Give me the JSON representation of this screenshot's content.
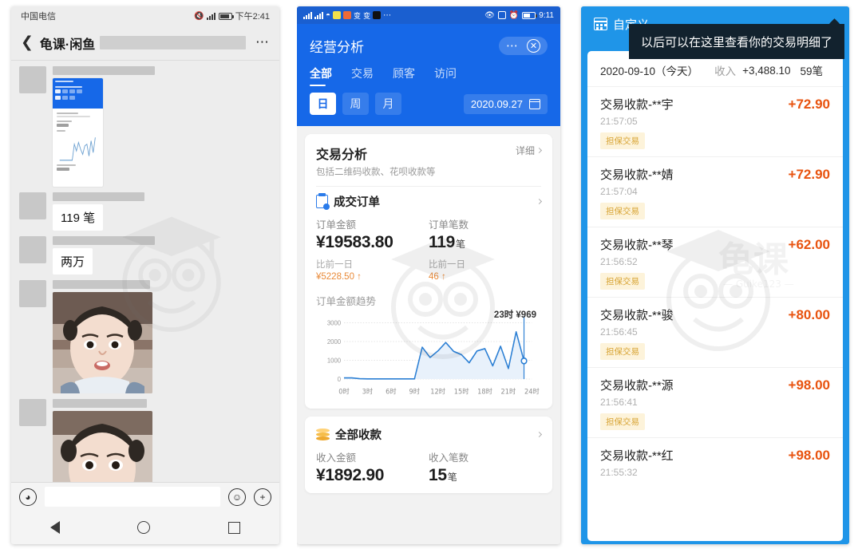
{
  "left_panel": {
    "status_bar": {
      "carrier": "中国电信",
      "time": "下午2:41",
      "mute_icon": "mute-icon",
      "signal_icon": "signal-icon",
      "battery_icon": "battery-icon"
    },
    "nav": {
      "back_icon": "back-chevron-icon",
      "title": "龟课·闲鱼",
      "more_icon": "more-dots-icon"
    },
    "messages": [
      {
        "type": "image",
        "name_masked": true,
        "thumb_alt": "business-analysis-screenshot"
      },
      {
        "type": "text",
        "text": "119 笔"
      },
      {
        "type": "text",
        "text": "两万"
      },
      {
        "type": "photo",
        "photo_alt": "child-portrait-1"
      },
      {
        "type": "photo",
        "photo_alt": "child-portrait-2"
      }
    ],
    "input_bar": {
      "voice_icon": "voice-icon",
      "placeholder": "",
      "value": "",
      "emoji_icon": "emoji-icon",
      "plus_icon": "plus-icon"
    },
    "system_nav": {
      "back_icon": "android-back-icon",
      "home_icon": "android-home-icon",
      "recents_icon": "android-recents-icon"
    }
  },
  "mid_panel": {
    "status_bar": {
      "time": "9:11",
      "icons": [
        "signal-icon",
        "signal-icon",
        "wifi-icon",
        "app-icon",
        "app-icon",
        "alipay-icon",
        "alipay-icon",
        "tiktok-icon",
        "more-icon"
      ],
      "right_icons": [
        "eye-icon",
        "nfc-icon",
        "alarm-icon",
        "battery-icon"
      ]
    },
    "header": {
      "title": "经营分析",
      "more_icon": "more-dots-icon",
      "close_icon": "close-icon"
    },
    "tabs": [
      {
        "label": "全部",
        "active": true
      },
      {
        "label": "交易",
        "active": false
      },
      {
        "label": "顾客",
        "active": false
      },
      {
        "label": "访问",
        "active": false
      }
    ],
    "ranges": [
      {
        "label": "日",
        "selected": true
      },
      {
        "label": "周",
        "selected": false
      },
      {
        "label": "月",
        "selected": false
      }
    ],
    "date_picker": {
      "value": "2020.09.27",
      "calendar_icon": "calendar-icon"
    },
    "trade_card": {
      "title": "交易分析",
      "subtitle": "包括二维码收款、花呗收款等",
      "detail_label": "详细",
      "detail_chevron": "chevron-right-icon",
      "section": {
        "icon": "order-clipboard-icon",
        "title": "成交订单",
        "chevron": "chevron-right-icon"
      },
      "stats": [
        {
          "label": "订单金额",
          "value": "¥19583.80",
          "unit": "",
          "compare_label": "比前一日",
          "delta": "¥5228.50 ↑"
        },
        {
          "label": "订单笔数",
          "value": "119",
          "unit": "笔",
          "compare_label": "比前一日",
          "delta": "46 ↑"
        }
      ],
      "trend_title": "订单金额趋势",
      "chart_note": "23时 ¥969"
    },
    "income_card": {
      "section": {
        "icon": "coins-icon",
        "title": "全部收款",
        "chevron": "chevron-right-icon"
      },
      "stats": [
        {
          "label": "收入金额",
          "value": "¥1892.90",
          "unit": ""
        },
        {
          "label": "收入笔数",
          "value": "15",
          "unit": "笔"
        }
      ]
    }
  },
  "right_panel": {
    "header": {
      "calendar_icon": "calendar-icon",
      "title": "自定义"
    },
    "tooltip": {
      "text": "以后可以在这里查看你的交易明细了"
    },
    "summary": {
      "date": "2020-09-10（今天）",
      "income_label": "收入",
      "income_amount": "+3,488.10",
      "count": "59笔"
    },
    "transactions": [
      {
        "title": "交易收款-**宇",
        "time": "21:57:05",
        "tag": "担保交易",
        "amount": "+72.90"
      },
      {
        "title": "交易收款-**婧",
        "time": "21:57:04",
        "tag": "担保交易",
        "amount": "+72.90"
      },
      {
        "title": "交易收款-**琴",
        "time": "21:56:52",
        "tag": "担保交易",
        "amount": "+62.00"
      },
      {
        "title": "交易收款-**骏",
        "time": "21:56:45",
        "tag": "担保交易",
        "amount": "+80.00"
      },
      {
        "title": "交易收款-**源",
        "time": "21:56:41",
        "tag": "担保交易",
        "amount": "+98.00"
      },
      {
        "title": "交易收款-**红",
        "time": "21:55:32",
        "tag": "",
        "amount": "+98.00"
      }
    ]
  },
  "colors": {
    "mid_header_blue": "#1668e8",
    "mid_status_blue": "#1a5fd0",
    "right_blue": "#1f95e8",
    "amount_orange": "#e8530f",
    "delta_orange": "#e98a38",
    "tag_bg": "#fdf3da",
    "tag_text": "#d8a434",
    "chart_line": "#2b7fd4"
  },
  "chart_data": {
    "type": "line",
    "title": "订单金额趋势",
    "xlabel": "",
    "ylabel": "",
    "ylim": [
      0,
      3000
    ],
    "yticks": [
      0,
      1000,
      2000,
      3000
    ],
    "xticks": [
      "0时",
      "3时",
      "6时",
      "9时",
      "12时",
      "15时",
      "18时",
      "21时",
      "24时"
    ],
    "grid": true,
    "legend": "none",
    "annotation": "23时 ¥969",
    "x": [
      0,
      1,
      2,
      3,
      4,
      5,
      6,
      7,
      8,
      9,
      10,
      11,
      12,
      13,
      14,
      15,
      16,
      17,
      18,
      19,
      20,
      21,
      22,
      23
    ],
    "values": [
      60,
      60,
      20,
      10,
      10,
      10,
      10,
      10,
      10,
      10,
      1700,
      1150,
      1500,
      1950,
      1480,
      1300,
      870,
      1500,
      1620,
      700,
      1750,
      560,
      2520,
      969
    ],
    "highlight_point": {
      "x": 23,
      "y": 969,
      "label": "23时 ¥969"
    }
  }
}
